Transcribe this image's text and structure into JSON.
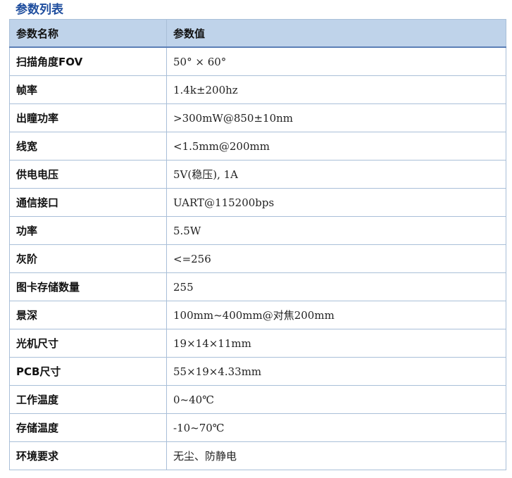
{
  "title": "参数列表",
  "table": {
    "headers": [
      "参数名称",
      "参数值"
    ],
    "rows": [
      {
        "name": "扫描角度FOV",
        "value": "50° × 60°"
      },
      {
        "name": "帧率",
        "value": "1.4k±200hz"
      },
      {
        "name": "出瞳功率",
        "value": ">300mW@850±10nm"
      },
      {
        "name": "线宽",
        "value": "<1.5mm@200mm"
      },
      {
        "name": "供电电压",
        "value": "5V(稳压), 1A"
      },
      {
        "name": "通信接口",
        "value": "UART@115200bps"
      },
      {
        "name": "功率",
        "value": "5.5W"
      },
      {
        "name": "灰阶",
        "value": "<=256"
      },
      {
        "name": "图卡存储数量",
        "value": "255"
      },
      {
        "name": "景深",
        "value": "100mm~400mm@对焦200mm"
      },
      {
        "name": "光机尺寸",
        "value": "19×14×11mm"
      },
      {
        "name": "PCB尺寸",
        "value": "55×19×4.33mm"
      },
      {
        "name": "工作温度",
        "value": "0~40℃"
      },
      {
        "name": "存储温度",
        "value": "-10~70℃"
      },
      {
        "name": "环境要求",
        "value": "无尘、防静电"
      }
    ]
  },
  "colors": {
    "title": "#1f4e9e",
    "header_bg": "#bfd3ea",
    "border": "#a9bfd8"
  }
}
